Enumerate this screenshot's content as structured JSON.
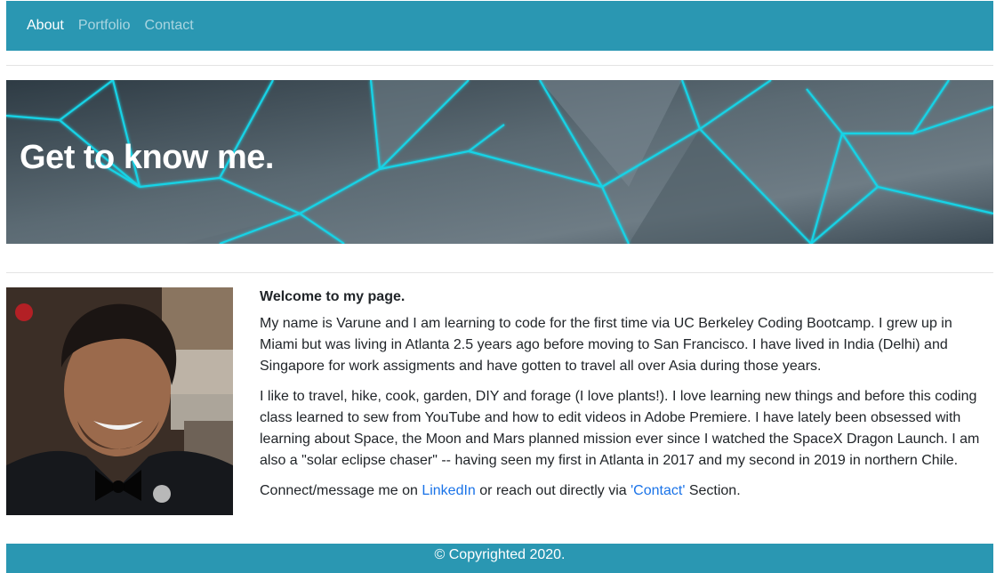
{
  "nav": {
    "items": [
      {
        "label": "About"
      },
      {
        "label": "Portfolio"
      },
      {
        "label": "Contact"
      }
    ]
  },
  "hero": {
    "title": "Get to know me."
  },
  "about": {
    "welcome": "Welcome to my page.",
    "paragraph1": "My name is Varune and I am learning to code for the first time via UC Berkeley Coding Bootcamp. I grew up in Miami but was living in Atlanta 2.5 years ago before moving to San Francisco. I have lived in India (Delhi) and Singapore for work assigments and have gotten to travel all over Asia during those years.",
    "paragraph2": "I like to travel, hike, cook, garden, DIY and forage (I love plants!). I love learning new things and before this coding class learned to sew from YouTube and how to edit videos in Adobe Premiere. I have lately been obsessed with learning about Space, the Moon and Mars planned mission ever since I watched the SpaceX Dragon Launch. I am also a \"solar eclipse chaser\" -- having seen my first in Atlanta in 2017 and my second in 2019 in northern Chile.",
    "connect_prefix": "Connect/message me on ",
    "linkedin_label": "LinkedIn",
    "connect_middle": " or reach out directly via ",
    "contact_label": "'Contact'",
    "connect_suffix": " Section."
  },
  "footer": {
    "text": "© Copyrighted 2020."
  },
  "colors": {
    "navbar": "#2a97b2",
    "link": "#1a73e8",
    "hero_line": "#19d3e6"
  }
}
